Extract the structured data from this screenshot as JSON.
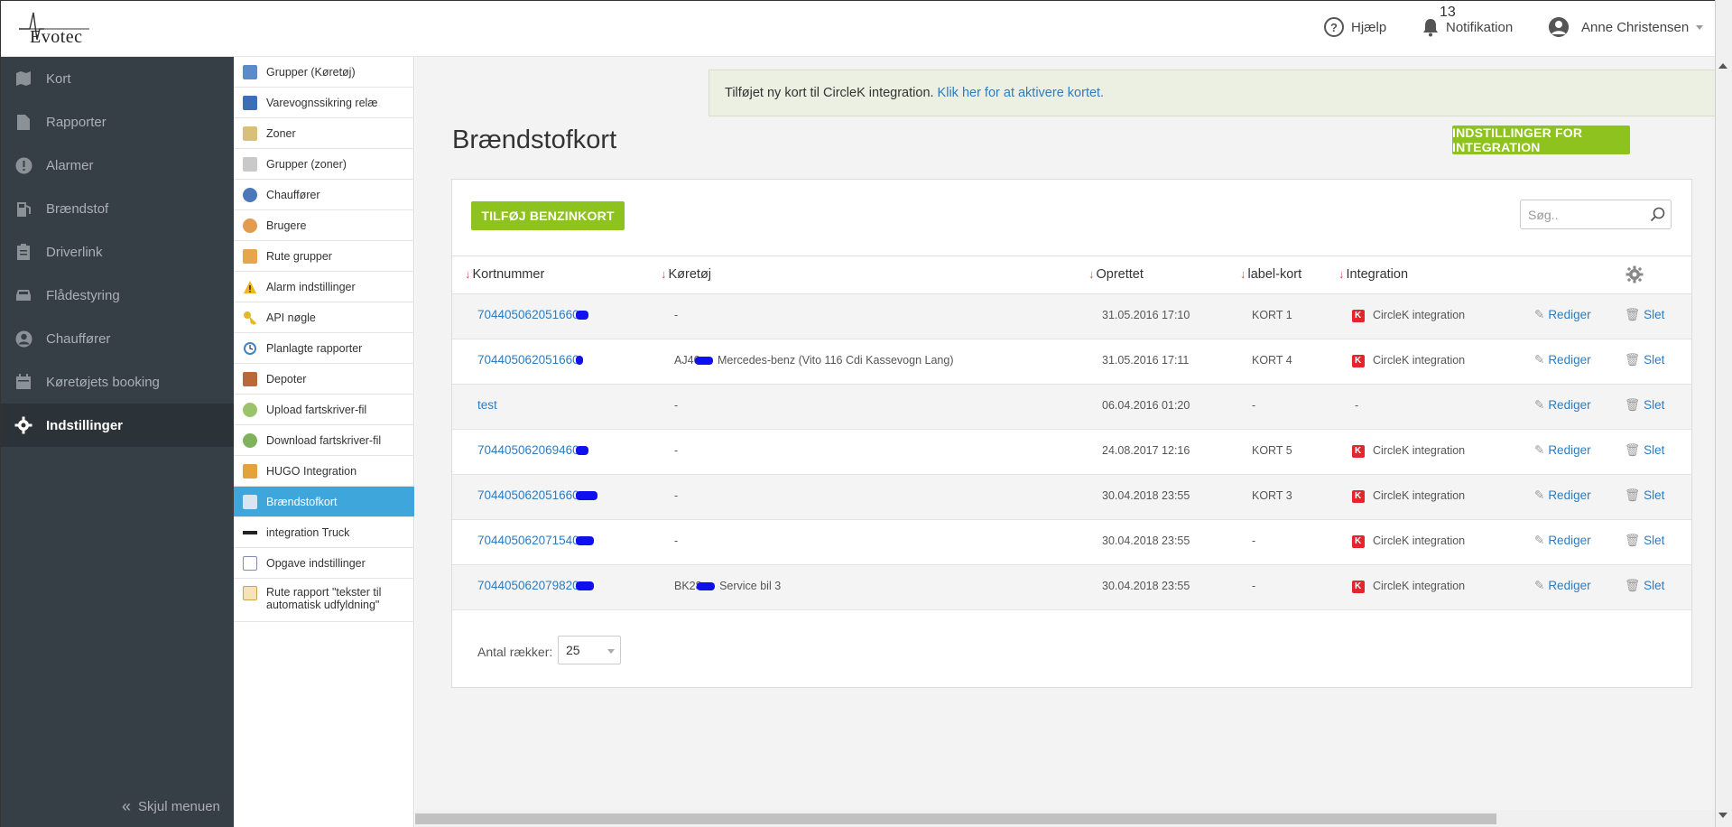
{
  "header": {
    "logo_text": "Evotec",
    "help_label": "Hjælp",
    "notifications_label": "Notifikation",
    "notifications_count": "13",
    "user_name": "Anne Christensen"
  },
  "sidebar": {
    "items": [
      {
        "label": "Kort",
        "icon": "map-icon"
      },
      {
        "label": "Rapporter",
        "icon": "document-icon"
      },
      {
        "label": "Alarmer",
        "icon": "alarm-icon"
      },
      {
        "label": "Brændstof",
        "icon": "fuel-icon"
      },
      {
        "label": "Driverlink",
        "icon": "clipboard-icon"
      },
      {
        "label": "Flådestyring",
        "icon": "car-icon"
      },
      {
        "label": "Chauffører",
        "icon": "person-icon"
      },
      {
        "label": "Køretøjets booking",
        "icon": "calendar-icon"
      },
      {
        "label": "Indstillinger",
        "icon": "gear-icon",
        "active": true
      }
    ],
    "collapse_label": "Skjul menuen"
  },
  "submenu": {
    "items": [
      {
        "label": "Grupper (Køretøj)"
      },
      {
        "label": "Varevognssikring relæ"
      },
      {
        "label": "Zoner"
      },
      {
        "label": "Grupper (zoner)"
      },
      {
        "label": "Chauffører"
      },
      {
        "label": "Brugere"
      },
      {
        "label": "Rute grupper"
      },
      {
        "label": "Alarm indstillinger"
      },
      {
        "label": "API nøgle"
      },
      {
        "label": "Planlagte rapporter"
      },
      {
        "label": "Depoter"
      },
      {
        "label": "Upload fartskriver-fil"
      },
      {
        "label": "Download fartskriver-fil"
      },
      {
        "label": "HUGO Integration"
      },
      {
        "label": "Brændstofkort",
        "active": true
      },
      {
        "label": "integration Truck"
      },
      {
        "label": "Opgave indstillinger"
      },
      {
        "label": "Rute rapport \"tekster til automatisk udfyldning\""
      }
    ]
  },
  "alert": {
    "text": "Tilføjet ny kort til CircleK integration.",
    "link": "Klik her for at aktivere kortet."
  },
  "page": {
    "title": "Brændstofkort",
    "integration_button": "INDSTILLINGER FOR INTEGRATION",
    "add_button": "TILFØJ BENZINKORT",
    "search_placeholder": "Søg.."
  },
  "table": {
    "columns": [
      "Kortnummer",
      "Køretøj",
      "Oprettet",
      "label-kort",
      "Integration"
    ],
    "edit_label": "Rediger",
    "delete_label": "Slet",
    "rows": [
      {
        "number": "704405062051660",
        "vehicle": "-",
        "created": "31.05.2016 17:10",
        "label": "KORT 1",
        "integration": "CircleK integration"
      },
      {
        "number": "704405062051660",
        "vehicle": "AJ46",
        "vehicle_rest": "Mercedes-benz (Vito 116 Cdi Kassevogn Lang)",
        "created": "31.05.2016 17:11",
        "label": "KORT 4",
        "integration": "CircleK integration"
      },
      {
        "number": "test",
        "vehicle": "-",
        "created": "06.04.2016 01:20",
        "label": "-",
        "integration": "-"
      },
      {
        "number": "704405062069460",
        "vehicle": "-",
        "created": "24.08.2017 12:16",
        "label": "KORT 5",
        "integration": "CircleK integration"
      },
      {
        "number": "704405062051660",
        "vehicle": "-",
        "created": "30.04.2018 23:55",
        "label": "KORT 3",
        "integration": "CircleK integration"
      },
      {
        "number": "704405062071540",
        "vehicle": "-",
        "created": "30.04.2018 23:55",
        "label": "-",
        "integration": "CircleK integration"
      },
      {
        "number": "704405062079820",
        "vehicle": "BK28",
        "vehicle_rest": "Service bil 3",
        "created": "30.04.2018 23:55",
        "label": "-",
        "integration": "CircleK integration"
      }
    ]
  },
  "pagination": {
    "rows_label": "Antal rækker:",
    "rows_value": "25"
  },
  "colors": {
    "accent_green": "#8dc21f",
    "link_blue": "#2d7cc0",
    "sidebar_bg": "#363f46",
    "submenu_active": "#3fa6dc"
  }
}
